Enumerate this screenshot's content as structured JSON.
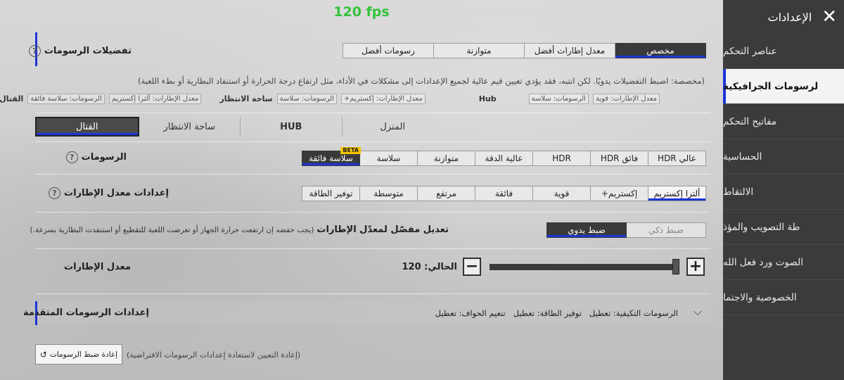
{
  "fps": "120 fps",
  "sidebar": {
    "title": "الإعدادات",
    "items": [
      {
        "label": "عناصر التحكم",
        "active": false
      },
      {
        "label": "لرسومات الجرافيكية",
        "active": true
      },
      {
        "label": "مفاتيح التحكم",
        "active": false
      },
      {
        "label": "الحساسية",
        "active": false
      },
      {
        "label": "الالتقاط",
        "active": false
      },
      {
        "label": "طة التصويب والمؤذ",
        "active": false
      },
      {
        "label": "الصوت ورد فعل الله",
        "active": false
      },
      {
        "label": "الخصوصية والاجتما",
        "active": false
      }
    ]
  },
  "graphics_prefs": {
    "label": "تفضيلات الرسومات",
    "options": [
      "مخصص",
      "معدل إطارات أفضل",
      "متوازنة",
      "رسومات أفضل"
    ],
    "selected": "مخصص",
    "description": "(مخصصة: اضبط التفضيلات يدويًا. لكن انتبه، فقد يؤدي تعيين قيم عالية لجميع الإعدادات إلى مشكلات في الأداء، مثل ارتفاع درجة الحرارة أو استنفاد البطارية أو بطء اللعبة)",
    "presets": [
      {
        "name": "",
        "tags": [
          "معدل الإطارات: قوية",
          "الرسومات: سلاسة"
        ]
      },
      {
        "name": "Hub",
        "tags": []
      },
      {
        "name": "ساحة الانتظار",
        "tags": [
          "معدل الإطارات: إكستريم+",
          "الرسومات: سلاسة"
        ]
      },
      {
        "name": "القتال",
        "tags": [
          "معدل الإطارات: ألترا إكستريم",
          "الرسومات: سلاسة فائقة"
        ]
      }
    ]
  },
  "mode_tabs": {
    "items": [
      "القتال",
      "ساحة الانتظار",
      "HUB",
      "المنزل"
    ],
    "selected": "القتال"
  },
  "graphics": {
    "label": "الرسومات",
    "options": [
      "عالي HDR",
      "فائق HDR",
      "HDR",
      "عالية الدقة",
      "متوازنة",
      "سلاسة",
      "سلاسة فائقة"
    ],
    "selected": "سلاسة فائقة",
    "beta_label": "BETA"
  },
  "frame_rate": {
    "label": "إعدادات معدل الإطارات",
    "options": [
      "ألترا إكستريم",
      "إكستريم+",
      "قوية",
      "فائقة",
      "مرتفع",
      "متوسطة",
      "توفير الطاقة"
    ],
    "selected": "ألترا إكستريم"
  },
  "adaptive": {
    "label": "تعديل مفصّل لمعدّل الإطارات",
    "note": "(يجب خفضه إن ارتفعت حرارة الجهاز أو تعرضت اللعبة للتقطيع أو استنفدت البطارية بسرعة.)",
    "options": [
      "ضبط ذكي",
      "ضبط يدوي"
    ],
    "selected": "ضبط يدوي"
  },
  "fps_slider": {
    "label": "معدل الإطارات",
    "current_text": "الحالي: 120",
    "fraction": 1.0
  },
  "advanced": {
    "label": "إعدادات الرسومات المتقدمة",
    "summary": "الرسومات التكيفية: تعطيل   توفير الطاقة: تعطيل   تنعيم الحواف: تعطيل"
  },
  "reset": {
    "button_label": "إعادة ضبط الرسومات",
    "note": "(إعادة التعيين لاستعادة إعدادات الرسومات الافتراضية)"
  }
}
